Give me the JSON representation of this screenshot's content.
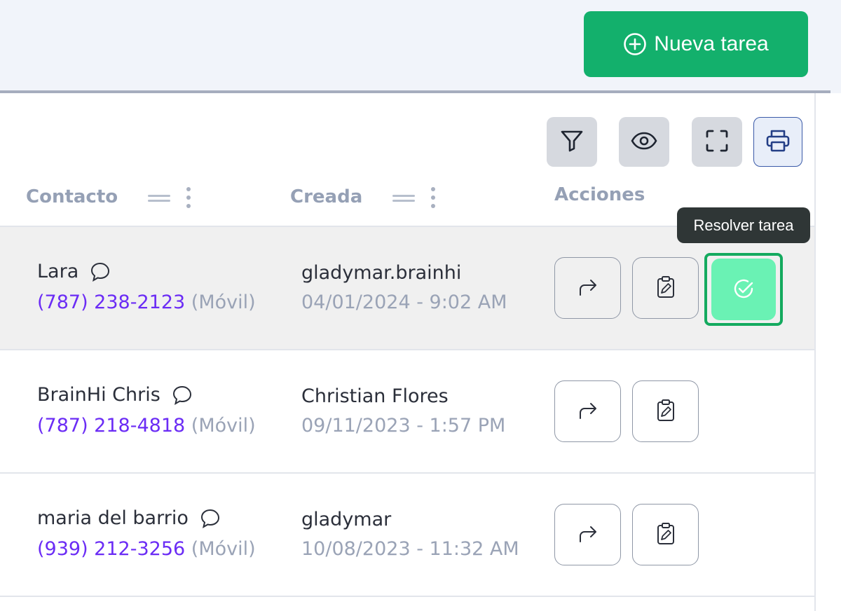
{
  "header": {
    "new_task_label": "Nueva tarea"
  },
  "toolbar": {
    "filter_icon": "filter-icon",
    "view_icon": "eye-icon",
    "fullscreen_icon": "fullscreen-icon",
    "print_icon": "printer-icon"
  },
  "columns": {
    "contact": "Contacto",
    "created": "Creada",
    "actions": "Acciones"
  },
  "tooltip": "Resolver tarea",
  "rows": [
    {
      "name": "Lara",
      "phone": "(787) 238-2123",
      "phone_type": "(Móvil)",
      "creator": "gladymar.brainhi",
      "date": "04/01/2024 - 9:02 AM"
    },
    {
      "name": "BrainHi Chris",
      "phone": "(787) 218-4818",
      "phone_type": "(Móvil)",
      "creator": "Christian Flores",
      "date": "09/11/2023 - 1:57 PM"
    },
    {
      "name": "maria del barrio",
      "phone": "(939) 212-3256",
      "phone_type": "(Móvil)",
      "creator": "gladymar",
      "date": "10/08/2023 - 11:32 AM"
    }
  ],
  "colors": {
    "primary_green": "#13b06c",
    "resolve_green": "#6af2b4",
    "phone_purple": "#6b2cf5"
  }
}
